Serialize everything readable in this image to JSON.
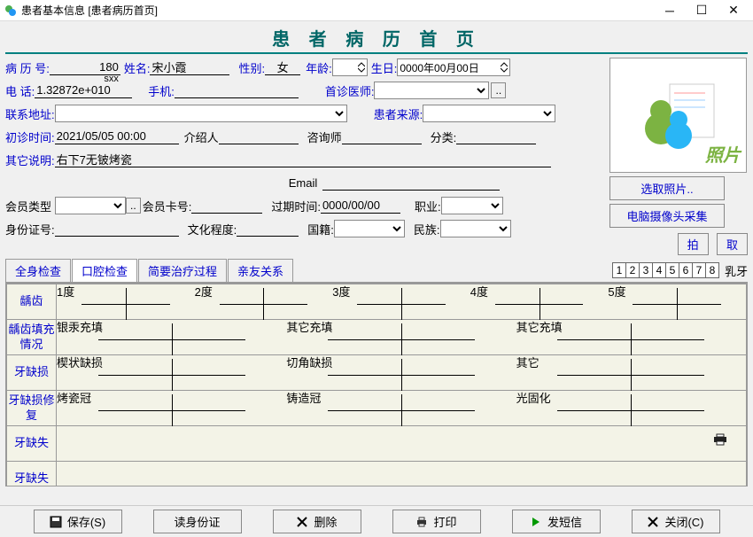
{
  "window": {
    "title": "患者基本信息   [患者病历首页]"
  },
  "header": {
    "title": "患 者 病 历 首 页"
  },
  "form": {
    "record_no_lbl": "病 历 号:",
    "record_no": "180",
    "pinyin": "sxx",
    "name_lbl": "姓名:",
    "name": "宋小霞",
    "gender_lbl": "性别:",
    "gender": "女",
    "age_lbl": "年龄:",
    "age": "",
    "birthday_lbl": "生日:",
    "birthday": "0000年00月00日",
    "phone_lbl": "电     话:",
    "phone": "1.32872e+010",
    "mobile_lbl": "手机:",
    "mobile": "",
    "first_doctor_lbl": "首诊医师:",
    "first_doctor": "",
    "addr_lbl": "联系地址:",
    "addr": "",
    "source_lbl": "患者来源:",
    "source": "",
    "first_visit_lbl": "初诊时间:",
    "first_visit": "2021/05/05 00:00",
    "introducer_lbl": "介绍人",
    "introducer": "",
    "consultant_lbl": "咨询师",
    "consultant": "",
    "category_lbl": "分类:",
    "category": "",
    "remarks_lbl": "其它说明:",
    "remarks": "右下7无铍烤瓷",
    "email_lbl": "Email",
    "email": "",
    "member_type_lbl": "会员类型",
    "member_type": "",
    "member_card_lbl": "会员卡号:",
    "member_card": "",
    "expire_lbl": "过期时间:",
    "expire": "0000/00/00",
    "occupation_lbl": "职业:",
    "occupation": "",
    "idcard_lbl": "身份证号:",
    "idcard": "",
    "education_lbl": "文化程度:",
    "education": "",
    "nationality_lbl": "国籍:",
    "nationality": "",
    "ethnicity_lbl": "民族:",
    "ethnicity": ""
  },
  "photo": {
    "label": "照片",
    "select_btn": "选取照片..",
    "camera_btn": "电脑摄像头采集",
    "capture_btn": "拍",
    "take_btn": "取"
  },
  "tabs": [
    "全身检查",
    "口腔检查",
    "简要治疗过程",
    "亲友关系"
  ],
  "active_tab": 1,
  "tooth_numbers": [
    "1",
    "2",
    "3",
    "4",
    "5",
    "6",
    "7",
    "8"
  ],
  "baby_tooth_lbl": "乳牙",
  "exam_grid": {
    "rows": [
      {
        "label": "龋齿",
        "texts": [
          "1度",
          "2度",
          "3度",
          "4度",
          "5度"
        ]
      },
      {
        "label": "龋齿填充情况",
        "texts": [
          "银汞充填",
          "其它充填",
          "其它充填"
        ]
      },
      {
        "label": "牙缺损",
        "texts": [
          "楔状缺损",
          "切角缺损",
          "其它"
        ]
      },
      {
        "label": "牙缺损修  复",
        "texts": [
          "烤瓷冠",
          "铸造冠",
          "光固化"
        ]
      },
      {
        "label": "牙缺失",
        "texts": []
      },
      {
        "label": "牙缺失",
        "texts": []
      }
    ]
  },
  "actions": {
    "save": "保存(S)",
    "read_id": "读身份证",
    "delete": "删除",
    "print": "打印",
    "sms": "发短信",
    "close": "关闭(C)"
  }
}
